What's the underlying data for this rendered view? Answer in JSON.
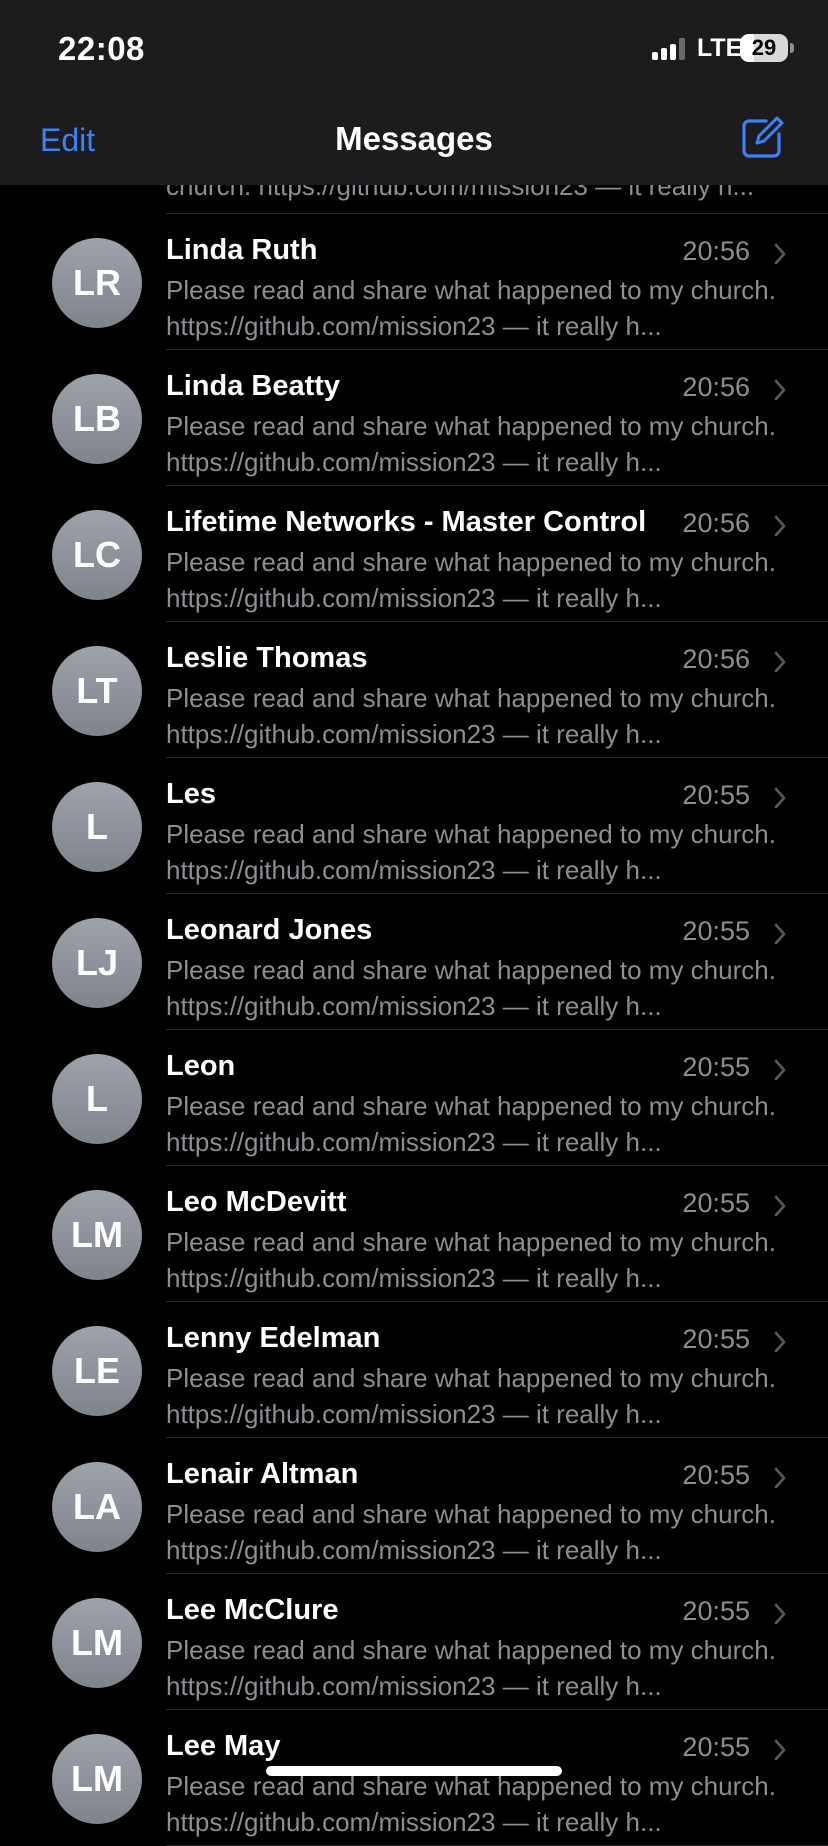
{
  "status_bar": {
    "time": "22:08",
    "network": "LTE",
    "battery_level": "29"
  },
  "nav": {
    "edit_label": "Edit",
    "title": "Messages",
    "compose_icon": "compose-icon"
  },
  "colors": {
    "accent": "#3b82f6",
    "background": "#000000",
    "header": "#1c1c1e",
    "secondary_text": "#8d8d93",
    "avatar": "#8e929b"
  },
  "conversations": [
    {
      "initials": "",
      "name": "",
      "time": "",
      "preview": "church. https://github.com/mission23 — it really h..."
    },
    {
      "initials": "LR",
      "name": "Linda Ruth",
      "time": "20:56",
      "preview": "Please read and share what happened to my church. https://github.com/mission23 — it really h..."
    },
    {
      "initials": "LB",
      "name": "Linda Beatty",
      "time": "20:56",
      "preview": "Please read and share what happened to my church. https://github.com/mission23 — it really h..."
    },
    {
      "initials": "LC",
      "name": "Lifetime Networks - Master Control",
      "time": "20:56",
      "preview": "Please read and share what happened to my church. https://github.com/mission23 — it really h..."
    },
    {
      "initials": "LT",
      "name": "Leslie Thomas",
      "time": "20:56",
      "preview": "Please read and share what happened to my church. https://github.com/mission23 — it really h..."
    },
    {
      "initials": "L",
      "name": "Les",
      "time": "20:55",
      "preview": "Please read and share what happened to my church. https://github.com/mission23 — it really h..."
    },
    {
      "initials": "LJ",
      "name": "Leonard Jones",
      "time": "20:55",
      "preview": "Please read and share what happened to my church. https://github.com/mission23 — it really h..."
    },
    {
      "initials": "L",
      "name": "Leon",
      "time": "20:55",
      "preview": "Please read and share what happened to my church. https://github.com/mission23 — it really h..."
    },
    {
      "initials": "LM",
      "name": "Leo McDevitt",
      "time": "20:55",
      "preview": "Please read and share what happened to my church. https://github.com/mission23 — it really h..."
    },
    {
      "initials": "LE",
      "name": "Lenny Edelman",
      "time": "20:55",
      "preview": "Please read and share what happened to my church. https://github.com/mission23 — it really h..."
    },
    {
      "initials": "LA",
      "name": "Lenair Altman",
      "time": "20:55",
      "preview": "Please read and share what happened to my church. https://github.com/mission23 — it really h..."
    },
    {
      "initials": "LM",
      "name": "Lee McClure",
      "time": "20:55",
      "preview": "Please read and share what happened to my church. https://github.com/mission23 — it really h..."
    },
    {
      "initials": "LM",
      "name": "Lee May",
      "time": "20:55",
      "preview": "Please read and share what happened to my church. https://github.com/mission23 — it really h..."
    }
  ]
}
